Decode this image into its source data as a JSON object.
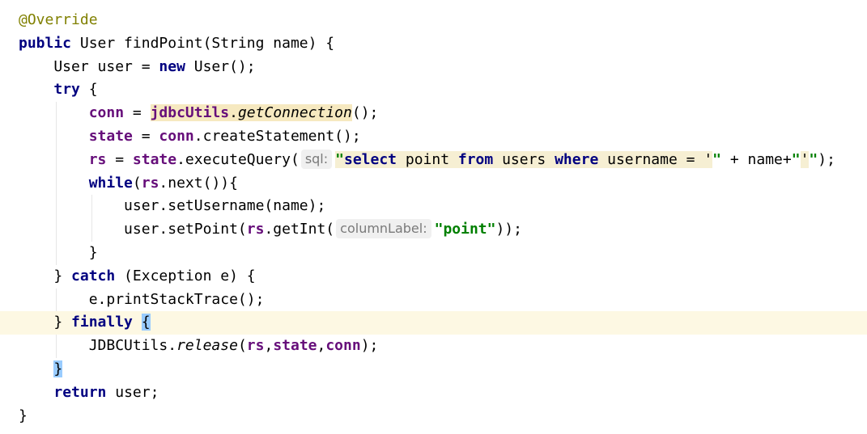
{
  "code_lines": [
    {
      "tokens": [
        {
          "t": "@Override",
          "c": "annotation"
        }
      ]
    },
    {
      "tokens": [
        {
          "t": "public",
          "c": "keyword"
        },
        {
          "t": " User findPoint(String name) {",
          "c": "plain"
        }
      ]
    },
    {
      "tokens": [
        {
          "t": "    User user = ",
          "c": "plain"
        },
        {
          "t": "new",
          "c": "keyword"
        },
        {
          "t": " User();",
          "c": "plain"
        }
      ]
    },
    {
      "tokens": [
        {
          "t": "    ",
          "c": "plain"
        },
        {
          "t": "try",
          "c": "keyword"
        },
        {
          "t": " {",
          "c": "plain"
        }
      ]
    },
    {
      "tokens": [
        {
          "t": "        ",
          "c": "plain"
        },
        {
          "t": "conn",
          "c": "field"
        },
        {
          "t": " = ",
          "c": "plain"
        },
        {
          "t": "jdbcUtils",
          "c": "field usage"
        },
        {
          "t": ".",
          "c": "plain usage"
        },
        {
          "t": "getConnection",
          "c": "italic usage"
        },
        {
          "t": "();",
          "c": "plain"
        }
      ]
    },
    {
      "tokens": [
        {
          "t": "        ",
          "c": "plain"
        },
        {
          "t": "state",
          "c": "field"
        },
        {
          "t": " = ",
          "c": "plain"
        },
        {
          "t": "conn",
          "c": "field"
        },
        {
          "t": ".createStatement();",
          "c": "plain"
        }
      ]
    },
    {
      "tokens": [
        {
          "t": "        ",
          "c": "plain"
        },
        {
          "t": "rs",
          "c": "field"
        },
        {
          "t": " = ",
          "c": "plain"
        },
        {
          "t": "state",
          "c": "field"
        },
        {
          "t": ".executeQuery(",
          "c": "plain"
        },
        {
          "t": "sql:",
          "c": "hint"
        },
        {
          "t": "\"",
          "c": "string sql"
        },
        {
          "t": "select",
          "c": "keyword sql"
        },
        {
          "t": " point ",
          "c": "plain sql"
        },
        {
          "t": "from",
          "c": "keyword sql"
        },
        {
          "t": " users ",
          "c": "plain sql"
        },
        {
          "t": "where",
          "c": "keyword sql"
        },
        {
          "t": " username = '",
          "c": "plain sql"
        },
        {
          "t": "\"",
          "c": "string"
        },
        {
          "t": " + name+",
          "c": "plain"
        },
        {
          "t": "\"",
          "c": "string"
        },
        {
          "t": "'",
          "c": "plain sql"
        },
        {
          "t": "\"",
          "c": "string"
        },
        {
          "t": ");",
          "c": "plain"
        }
      ]
    },
    {
      "tokens": [
        {
          "t": "        ",
          "c": "plain"
        },
        {
          "t": "while",
          "c": "keyword"
        },
        {
          "t": "(",
          "c": "plain"
        },
        {
          "t": "rs",
          "c": "field"
        },
        {
          "t": ".next()){",
          "c": "plain"
        }
      ]
    },
    {
      "tokens": [
        {
          "t": "            user.setUsername(name);",
          "c": "plain"
        }
      ]
    },
    {
      "tokens": [
        {
          "t": "            user.setPoint(",
          "c": "plain"
        },
        {
          "t": "rs",
          "c": "field"
        },
        {
          "t": ".getInt(",
          "c": "plain"
        },
        {
          "t": "columnLabel:",
          "c": "hint"
        },
        {
          "t": "\"point\"",
          "c": "string"
        },
        {
          "t": "));",
          "c": "plain"
        }
      ]
    },
    {
      "tokens": [
        {
          "t": "        }",
          "c": "plain"
        }
      ]
    },
    {
      "tokens": [
        {
          "t": "    } ",
          "c": "plain"
        },
        {
          "t": "catch",
          "c": "keyword"
        },
        {
          "t": " (Exception e) {",
          "c": "plain"
        }
      ]
    },
    {
      "tokens": [
        {
          "t": "        e.printStackTrace();",
          "c": "plain"
        }
      ]
    },
    {
      "tokens": [
        {
          "t": "    } ",
          "c": "plain"
        },
        {
          "t": "finally",
          "c": "keyword"
        },
        {
          "t": " ",
          "c": "plain"
        },
        {
          "t": "{",
          "c": "plain brace"
        }
      ],
      "current": true
    },
    {
      "tokens": [
        {
          "t": "        JDBCUtils.",
          "c": "plain"
        },
        {
          "t": "release",
          "c": "italic"
        },
        {
          "t": "(",
          "c": "plain"
        },
        {
          "t": "rs",
          "c": "field"
        },
        {
          "t": ",",
          "c": "plain"
        },
        {
          "t": "state",
          "c": "field"
        },
        {
          "t": ",",
          "c": "plain"
        },
        {
          "t": "conn",
          "c": "field"
        },
        {
          "t": ");",
          "c": "plain"
        }
      ]
    },
    {
      "tokens": [
        {
          "t": "    ",
          "c": "plain"
        },
        {
          "t": "}",
          "c": "plain brace"
        }
      ]
    },
    {
      "tokens": [
        {
          "t": "    ",
          "c": "plain"
        },
        {
          "t": "return",
          "c": "keyword"
        },
        {
          "t": " user;",
          "c": "plain"
        }
      ]
    },
    {
      "tokens": [
        {
          "t": "}",
          "c": "plain"
        }
      ]
    }
  ],
  "colors": {
    "background": "#ffffff",
    "current_line": "#fdf8e3",
    "keyword": "#000080",
    "field": "#660e7a",
    "string": "#008000",
    "annotation": "#808000",
    "usage_highlight": "#f6e9c0",
    "brace_match": "#99ccff"
  }
}
